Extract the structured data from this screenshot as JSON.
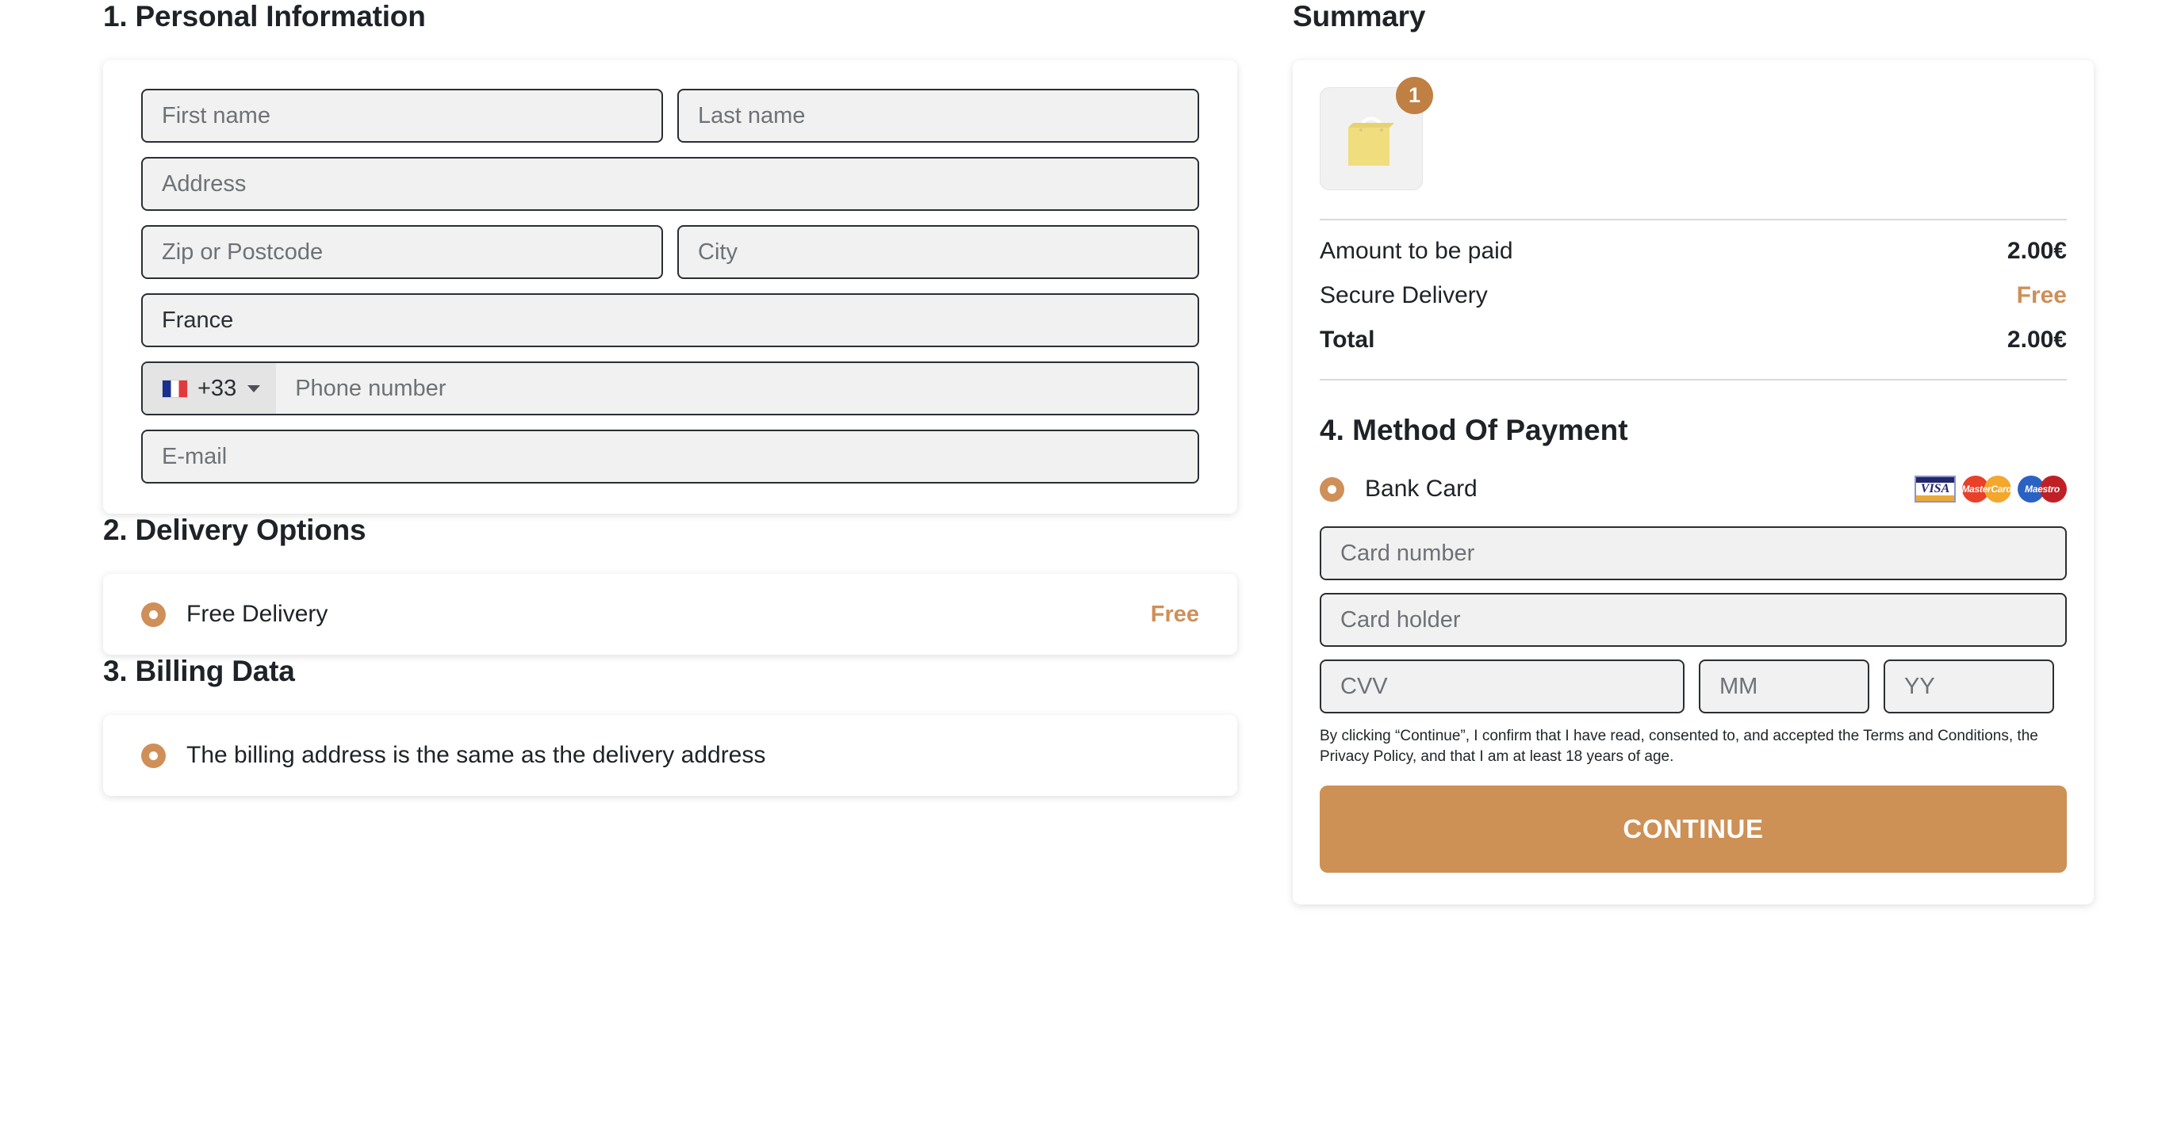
{
  "personal": {
    "title": "1. Personal Information",
    "first_name_placeholder": "First name",
    "last_name_placeholder": "Last name",
    "address_placeholder": "Address",
    "zip_placeholder": "Zip or Postcode",
    "city_placeholder": "City",
    "country_value": "France",
    "phone_dial_code": "+33",
    "phone_placeholder": "Phone number",
    "email_placeholder": "E-mail"
  },
  "delivery": {
    "title": "2. Delivery Options",
    "option_label": "Free Delivery",
    "option_price": "Free"
  },
  "billing": {
    "title": "3. Billing Data",
    "option_label": "The billing address is the same as the delivery address"
  },
  "summary": {
    "title": "Summary",
    "item_quantity": "1",
    "rows": [
      {
        "label": "Amount to be paid",
        "value": "2.00€",
        "accent": false
      },
      {
        "label": "Secure Delivery",
        "value": "Free",
        "accent": true
      },
      {
        "label": "Total",
        "value": "2.00€",
        "accent": false
      }
    ]
  },
  "payment": {
    "title": "4. Method Of Payment",
    "method_label": "Bank Card",
    "logos": [
      {
        "name": "visa",
        "text": "VISA"
      },
      {
        "name": "mastercard",
        "text": "MasterCard"
      },
      {
        "name": "maestro",
        "text": "Maestro"
      }
    ],
    "card_number_placeholder": "Card number",
    "card_holder_placeholder": "Card holder",
    "cvv_placeholder": "CVV",
    "month_placeholder": "MM",
    "year_placeholder": "YY",
    "disclaimer": "By clicking “Continue”, I confirm that I have read, consented to, and accepted the Terms and Conditions, the Privacy Policy, and that I am at least 18 years of age.",
    "continue_label": "CONTINUE"
  },
  "colors": {
    "accent": "#cf8f58",
    "button": "#cd9055",
    "badge": "#c07f43",
    "field_bg": "#f1f1f1",
    "field_border": "#2b2e33"
  }
}
